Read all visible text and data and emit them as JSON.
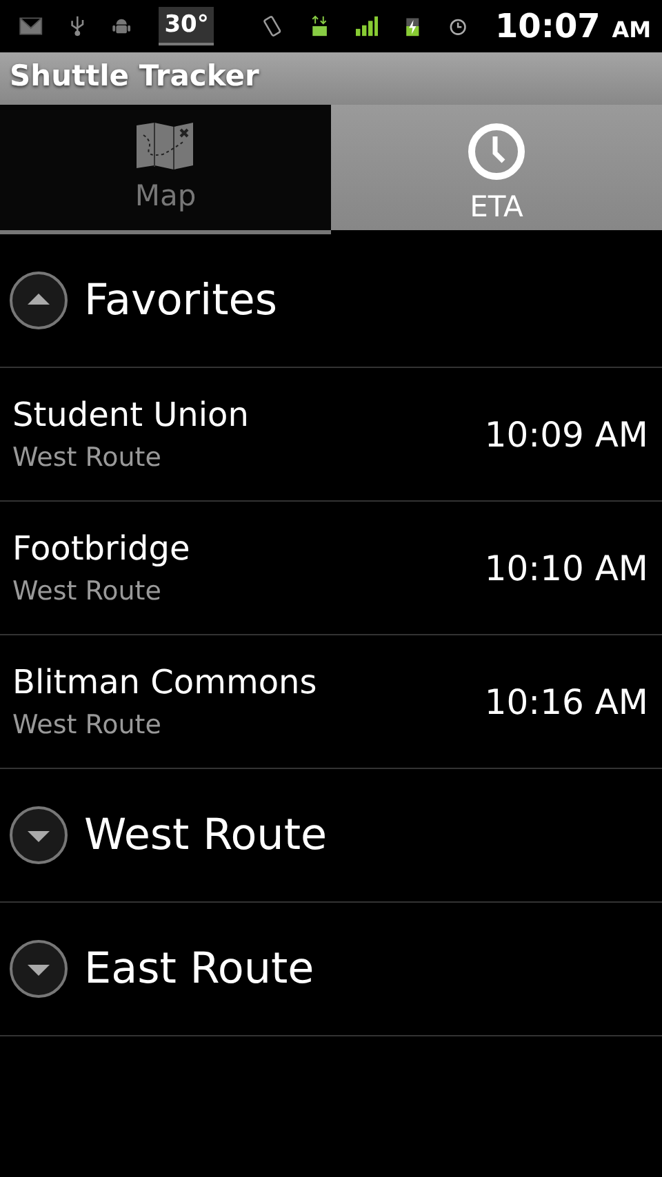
{
  "status_bar": {
    "temperature": "30°",
    "time": "10:07",
    "meridiem": "AM"
  },
  "window": {
    "title": "Shuttle Tracker"
  },
  "tabs": [
    {
      "label": "Map",
      "selected": false
    },
    {
      "label": "ETA",
      "selected": true
    }
  ],
  "groups": [
    {
      "title": "Favorites",
      "expanded": true,
      "stops": [
        {
          "name": "Student Union",
          "route": "West Route",
          "eta": "10:09 AM"
        },
        {
          "name": "Footbridge",
          "route": "West Route",
          "eta": "10:10 AM"
        },
        {
          "name": "Blitman Commons",
          "route": "West Route",
          "eta": "10:16 AM"
        }
      ]
    },
    {
      "title": "West Route",
      "expanded": false
    },
    {
      "title": "East Route",
      "expanded": false
    }
  ]
}
